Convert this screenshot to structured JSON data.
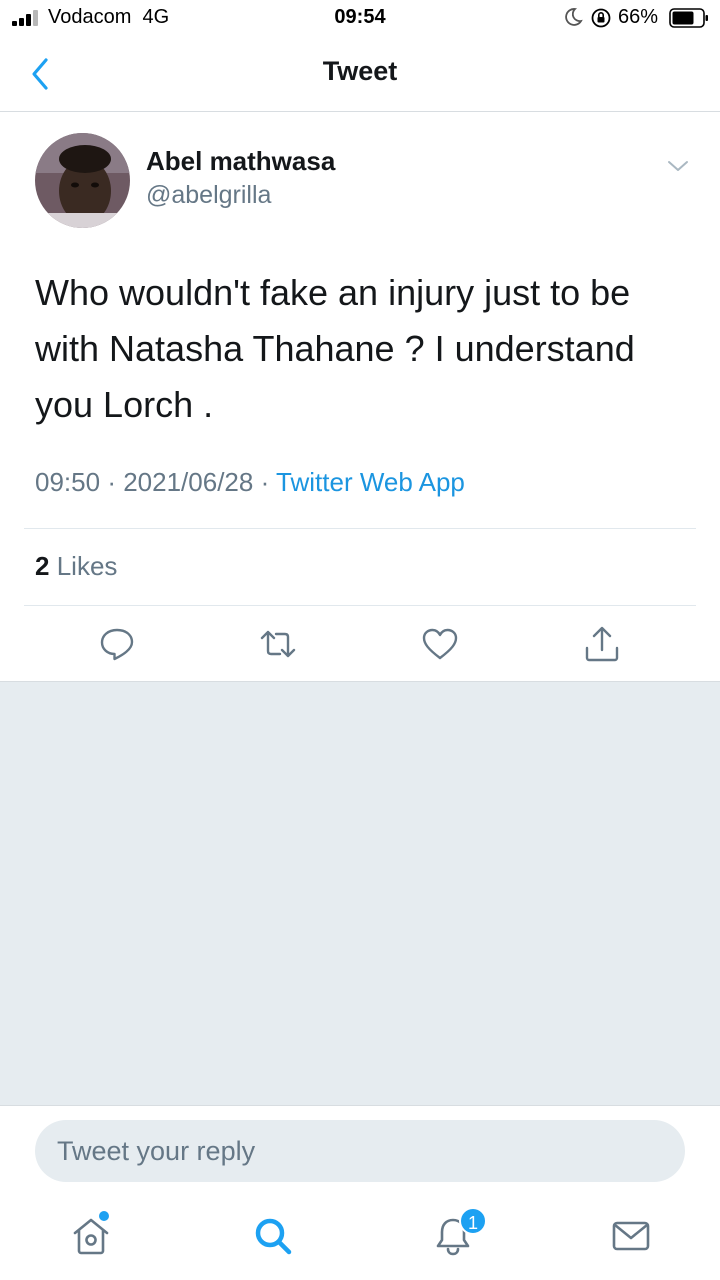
{
  "status_bar": {
    "carrier": "Vodacom",
    "network": "4G",
    "time": "09:54",
    "battery_percent": "66%",
    "icons": [
      "signal-icon",
      "moon-icon",
      "rotation-lock-icon",
      "battery-icon"
    ]
  },
  "header": {
    "title": "Tweet",
    "back_icon": "chevron-left-icon"
  },
  "tweet": {
    "display_name": "Abel mathwasa",
    "handle": "@abelgrilla",
    "text": "Who wouldn't fake an injury just to be with Natasha Thahane ? I understand you Lorch .",
    "time": "09:50",
    "date": "2021/06/28",
    "separator": "·",
    "source": "Twitter Web App",
    "likes_count": "2",
    "likes_label": "Likes",
    "actions": [
      "reply-icon",
      "retweet-icon",
      "like-icon",
      "share-icon"
    ]
  },
  "reply": {
    "placeholder": "Tweet your reply"
  },
  "tab_bar": {
    "items": [
      "home-icon",
      "search-icon",
      "notifications-icon",
      "messages-icon"
    ],
    "notification_badge": "1"
  },
  "colors": {
    "accent": "#1da1f2",
    "link": "#1b95e0",
    "secondary_text": "#657786",
    "background_gray": "#e6ecf0"
  }
}
